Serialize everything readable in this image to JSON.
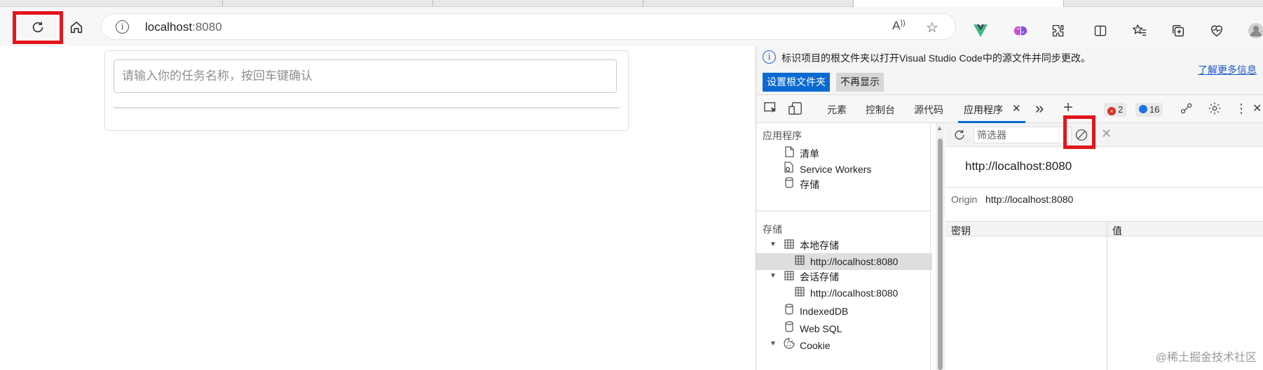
{
  "browser": {
    "address_bar": {
      "host": "localhost",
      "port": ":8080"
    },
    "toolbar_icons": [
      "refresh-icon",
      "home-icon",
      "read-aloud-icon",
      "favorite-star-icon"
    ],
    "extension_icons": [
      "vue-devtools-icon",
      "brain-extension-icon",
      "puzzle-extensions-icon",
      "split-screen-icon",
      "favorites-list-icon",
      "collections-icon",
      "health-icon"
    ]
  },
  "page": {
    "task_input": {
      "placeholder": "请输入你的任务名称，按回车键确认",
      "value": ""
    }
  },
  "devtools": {
    "infobar": {
      "message": "标识项目的根文件夹以打开Visual Studio Code中的源文件并同步更改。",
      "learn_more": "了解更多信息",
      "set_root_button": "设置根文件夹",
      "dont_show_button": "不再显示"
    },
    "tabs": [
      {
        "label": "元素"
      },
      {
        "label": "控制台"
      },
      {
        "label": "源代码"
      },
      {
        "label": "应用程序",
        "active": true
      }
    ],
    "close_tab_glyph": "✕",
    "more_tabs_glyph": "»",
    "add_tab_glyph": "+",
    "errors_count": "2",
    "messages_count": "16",
    "sidebar": {
      "application_title": "应用程序",
      "application_items": [
        "清单",
        "Service Workers",
        "存储"
      ],
      "storage_title": "存储",
      "local_storage_label": "本地存储",
      "local_storage_origin": "http://localhost:8080",
      "session_storage_label": "会话存储",
      "session_storage_origin": "http://localhost:8080",
      "indexeddb_label": "IndexedDB",
      "websql_label": "Web SQL",
      "cookie_label": "Cookie"
    },
    "storage_pane": {
      "filter_placeholder": "筛选器",
      "origin_title": "http://localhost:8080",
      "origin_label": "Origin",
      "origin_value": "http://localhost:8080",
      "columns": [
        "密钥",
        "值"
      ]
    }
  },
  "colors": {
    "highlight_box": "#e3161b",
    "primary_button": "#0a6ad2",
    "link": "#1a56c9",
    "error_badge": "#d93025",
    "message_badge": "#1a73e8"
  },
  "watermark": "@稀土掘金技术社区"
}
